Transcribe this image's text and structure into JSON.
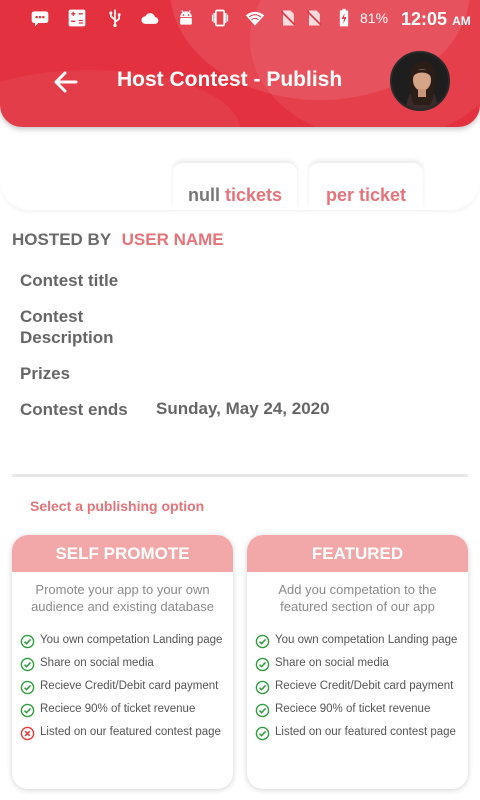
{
  "status_bar": {
    "battery": "81%",
    "time": "12:05",
    "ampm": "AM",
    "icons": [
      "message-icon",
      "calculator-icon",
      "usb-icon",
      "cloud-icon",
      "android-icon",
      "vibrate-icon",
      "wifi-icon",
      "no-sim-icon",
      "no-sim-icon",
      "battery-charging-icon"
    ]
  },
  "header": {
    "title": "Host Contest - Publish",
    "back_icon": "arrow-left-icon",
    "avatar": "user-avatar"
  },
  "tickets": {
    "count": "null",
    "count_unit": "tickets",
    "price": "",
    "price_unit": "per ticket"
  },
  "hosted_by": {
    "label": "HOSTED BY",
    "user": "USER NAME"
  },
  "info": {
    "title_label": "Contest title",
    "description_label": "Contest Description",
    "prizes_label": "Prizes",
    "ends_label": "Contest ends",
    "ends_value": "Sunday, May 24, 2020"
  },
  "publish": {
    "select_label": "Select a publishing option",
    "options": [
      {
        "title": "SELF PROMOTE",
        "description": "Promote your app to your own audience and existing database",
        "features": [
          {
            "text": "You own competation Landing page",
            "included": true
          },
          {
            "text": "Share on social media",
            "included": true
          },
          {
            "text": "Recieve Credit/Debit card payment",
            "included": true
          },
          {
            "text": "Reciece 90% of ticket revenue",
            "included": true
          },
          {
            "text": "Listed on our featured contest page",
            "included": false
          }
        ]
      },
      {
        "title": "FEATURED",
        "description": "Add you competation to the featured section of our app",
        "features": [
          {
            "text": "You own competation Landing page",
            "included": true
          },
          {
            "text": "Share on social media",
            "included": true
          },
          {
            "text": "Recieve Credit/Debit card payment",
            "included": true
          },
          {
            "text": "Reciece 90% of ticket revenue",
            "included": true
          },
          {
            "text": "Listed on our featured contest page",
            "included": true
          }
        ]
      }
    ]
  },
  "colors": {
    "header": "#e3313f",
    "accent": "#e57379",
    "card_header": "#f2a7a8",
    "check": "#2e9e3e",
    "cross": "#e53935"
  }
}
